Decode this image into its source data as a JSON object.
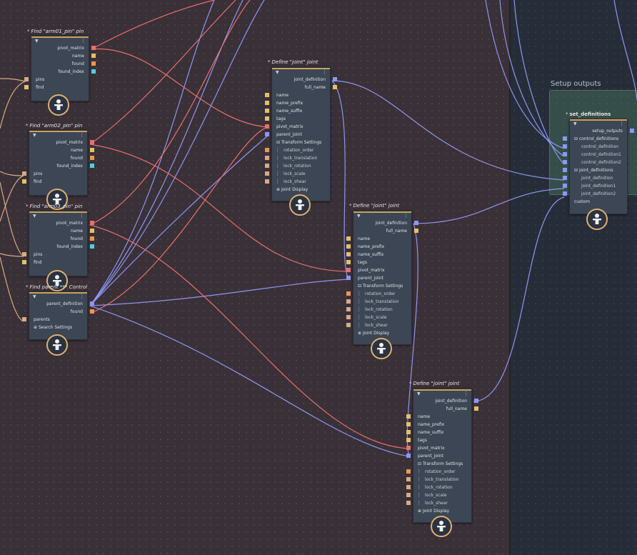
{
  "group": {
    "title": "Setup outputs"
  },
  "find_nodes": [
    {
      "title": "Find \"arm01_pin\" pin",
      "outputs": [
        "pivot_matrix",
        "name",
        "found",
        "found_index"
      ],
      "inputs": [
        "pins",
        "find"
      ]
    },
    {
      "title": "Find \"arm02_pin\" pin",
      "outputs": [
        "pivot_matrix",
        "name",
        "found",
        "found_index"
      ],
      "inputs": [
        "pins",
        "find"
      ]
    },
    {
      "title": "Find \"arm03_pin\" pin",
      "outputs": [
        "pivot_matrix",
        "name",
        "found",
        "found_index"
      ],
      "inputs": [
        "pins",
        "find"
      ]
    }
  ],
  "parent_node": {
    "title": "Find parent *** Control",
    "outputs": [
      "parent_definition",
      "found"
    ],
    "inputs": [
      "parents"
    ],
    "section": "Search Settings"
  },
  "joint_nodes": [
    {
      "title": "Define \"joint\" joint"
    },
    {
      "title": "Define \"joint\" joint"
    },
    {
      "title": "Define \"joint\" joint"
    }
  ],
  "joint_template": {
    "outputs": [
      "joint_definition",
      "full_name"
    ],
    "inputs": [
      "name",
      "name_prefix",
      "name_suffix",
      "tags",
      "pivot_matrix",
      "parent_joint"
    ],
    "transform_section": "Transform Settings",
    "transform_items": [
      "rotation_order",
      "lock_translation",
      "lock_rotation",
      "lock_scale",
      "lock_shear"
    ],
    "display_section": "Joint Display"
  },
  "set_node": {
    "title": "set_definitions",
    "output": "setup_outputs",
    "control_group": "control_definitions",
    "controls": [
      "control_definition",
      "control_definition1",
      "control_definition2"
    ],
    "joint_group": "joint_definitions",
    "joints": [
      "joint_definition",
      "joint_definition1",
      "joint_definition2"
    ],
    "custom": "custom"
  },
  "colors": {
    "canvas": "#3a3037",
    "node": "#3c4654",
    "accent": "#c9a35a",
    "wire_red": "#e8706e",
    "wire_blue": "#8e96f4",
    "wire_tan": "#d7ab86"
  }
}
